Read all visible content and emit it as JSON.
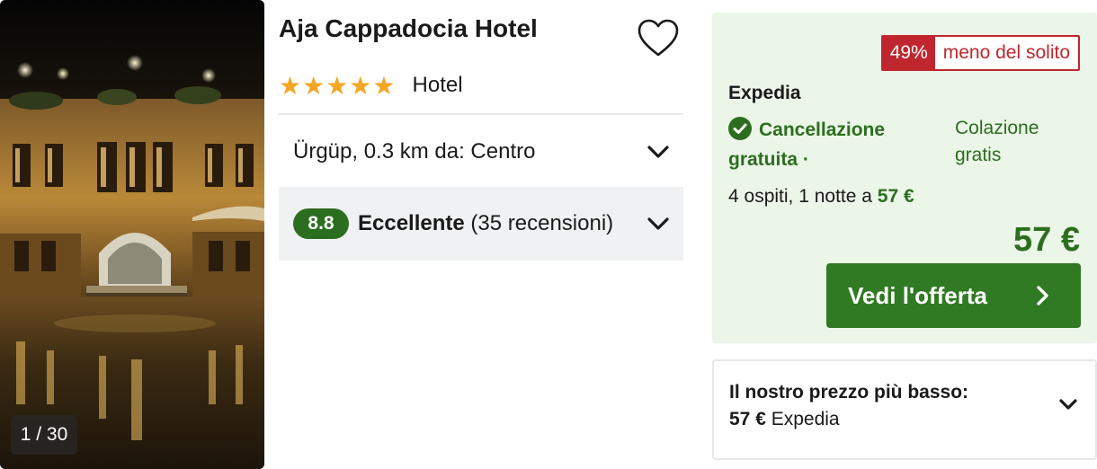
{
  "photo": {
    "counter": "1 / 30"
  },
  "hotel": {
    "name": "Aja Cappadocia Hotel",
    "stars": "★★★★★",
    "type": "Hotel",
    "location": "Ürgüp, 0.3 km da: Centro"
  },
  "rating": {
    "score": "8.8",
    "label": "Eccellente",
    "reviews": "(35 recensioni)"
  },
  "offer": {
    "discount_pct": "49%",
    "discount_label": "meno del solito",
    "provider": "Expedia",
    "cancellation": "Cancellazione gratuita ·",
    "breakfast": "Colazione gratis",
    "guests_text": "4 ospiti, 1 notte a",
    "guests_price": "57 €",
    "price": "57 €",
    "cta": "Vedi l'offerta"
  },
  "lowest": {
    "title": "Il nostro prezzo più basso:",
    "price": "57 €",
    "provider": "Expedia"
  },
  "colors": {
    "green": "#2c6e1f",
    "offer_bg": "#ebf5e8",
    "discount_red": "#c0262d",
    "star": "#f5a623"
  },
  "icons": [
    "heart-icon",
    "chevron-down-icon",
    "check-circle-icon",
    "chevron-right-icon"
  ]
}
